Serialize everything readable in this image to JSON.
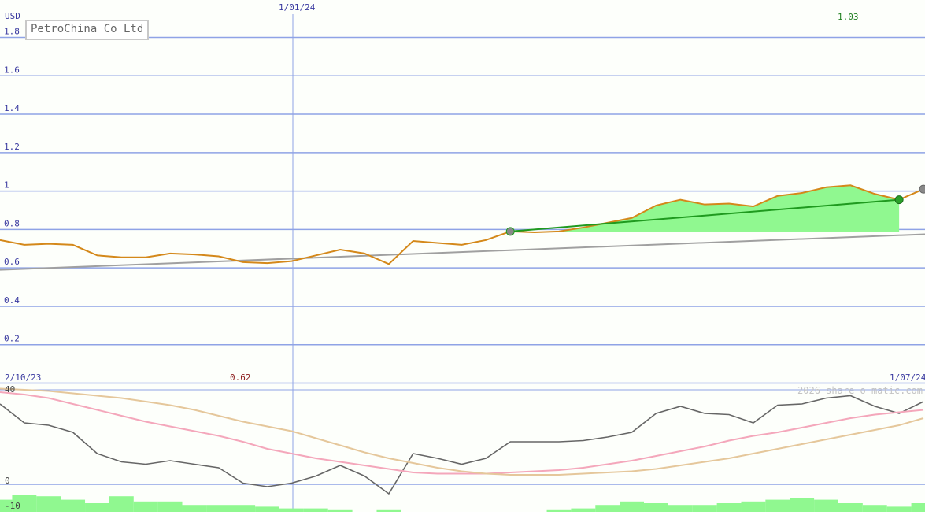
{
  "title": "PetroChina Co Ltd",
  "watermark": "2026 share-o-matic.com",
  "colors": {
    "background": "#fdfffb",
    "grid": "#8fa3e6",
    "axis_text": "#3a3aa0",
    "price": "#d4881a",
    "trend": "#a0a0a0",
    "highlight_fill": "#90f890",
    "highlight_line": "#1f9a1f",
    "marker_gray": "#888888",
    "marker_green": "#2aa02a",
    "osc": "#666666",
    "avg_pink": "#f4a7bb",
    "avg_tan": "#e5c79b",
    "volume": "#90f890",
    "high_label": "#208020",
    "low_label": "#8b1a1a"
  },
  "chart_data": {
    "type": "line",
    "currency_label": "USD",
    "start_label": "2/10/23",
    "end_label": "1/07/24",
    "mid_date_label": "1/01/24",
    "high_label": "1.03",
    "low_label": "0.62",
    "ylim": [
      0,
      1.8
    ],
    "yticks": [
      "1.8",
      "1.6",
      "1.4",
      "1.2",
      "1",
      "0.8",
      "0.6",
      "0.4",
      "0.2"
    ],
    "grid": true,
    "price": {
      "values": [
        0.745,
        0.72,
        0.725,
        0.72,
        0.665,
        0.655,
        0.655,
        0.675,
        0.67,
        0.66,
        0.63,
        0.625,
        0.635,
        0.665,
        0.695,
        0.675,
        0.62,
        0.74,
        0.73,
        0.72,
        0.745,
        0.79,
        0.785,
        0.79,
        0.81,
        0.835,
        0.86,
        0.925,
        0.955,
        0.93,
        0.935,
        0.92,
        0.975,
        0.99,
        1.02,
        1.03,
        0.985,
        0.955,
        1.01
      ]
    },
    "trend_line": {
      "start": 0.59,
      "end": 0.775
    },
    "highlight": {
      "start_index": 21,
      "end_index": 37,
      "start_value": 0.79,
      "end_value": 0.955,
      "base": 0.785
    },
    "oscillator": {
      "yticks": [
        "40",
        "0",
        "-10"
      ],
      "ylim": [
        -10,
        40
      ],
      "series": [
        {
          "values": [
            34,
            26,
            25,
            22,
            13,
            9.5,
            8.5,
            10,
            8.5,
            7,
            0.5,
            -1,
            0.5,
            3.5,
            8,
            3.5,
            -4,
            13,
            11,
            8.5,
            11,
            18,
            18,
            18,
            18.5,
            20,
            22,
            30,
            33,
            30,
            29.5,
            26,
            33.5,
            34,
            36.5,
            37.5,
            33,
            30,
            35
          ]
        },
        {
          "values": [
            39,
            38,
            36.5,
            34,
            31.5,
            29,
            26.5,
            24.5,
            22.5,
            20.5,
            18,
            15,
            13,
            11,
            9.5,
            8,
            6.5,
            5,
            4.5,
            4.5,
            4.5,
            5,
            5.5,
            6,
            7,
            8.5,
            10,
            12,
            14,
            16,
            18.5,
            20.5,
            22,
            24,
            26,
            28,
            29.5,
            30.5,
            31.5
          ]
        },
        {
          "values": [
            40.5,
            40,
            39.5,
            38.5,
            37.5,
            36.5,
            35,
            33.5,
            31.5,
            29,
            26.5,
            24.5,
            22.5,
            19.5,
            16.5,
            13.5,
            11,
            9,
            7,
            5.5,
            4.5,
            4,
            4,
            4,
            4.5,
            5,
            5.5,
            6.5,
            8,
            9.5,
            11,
            13,
            15,
            17,
            19,
            21,
            23,
            25,
            28
          ]
        }
      ]
    },
    "volume": {
      "values": [
        0.35,
        0.5,
        0.45,
        0.35,
        0.25,
        0.45,
        0.3,
        0.3,
        0.2,
        0.2,
        0.2,
        0.15,
        0.1,
        0.1,
        0.05,
        0,
        0.05,
        0,
        0,
        0,
        0,
        0,
        0,
        0.05,
        0.1,
        0.2,
        0.3,
        0.25,
        0.2,
        0.2,
        0.25,
        0.3,
        0.35,
        0.4,
        0.35,
        0.25,
        0.2,
        0.15,
        0.25
      ]
    }
  }
}
